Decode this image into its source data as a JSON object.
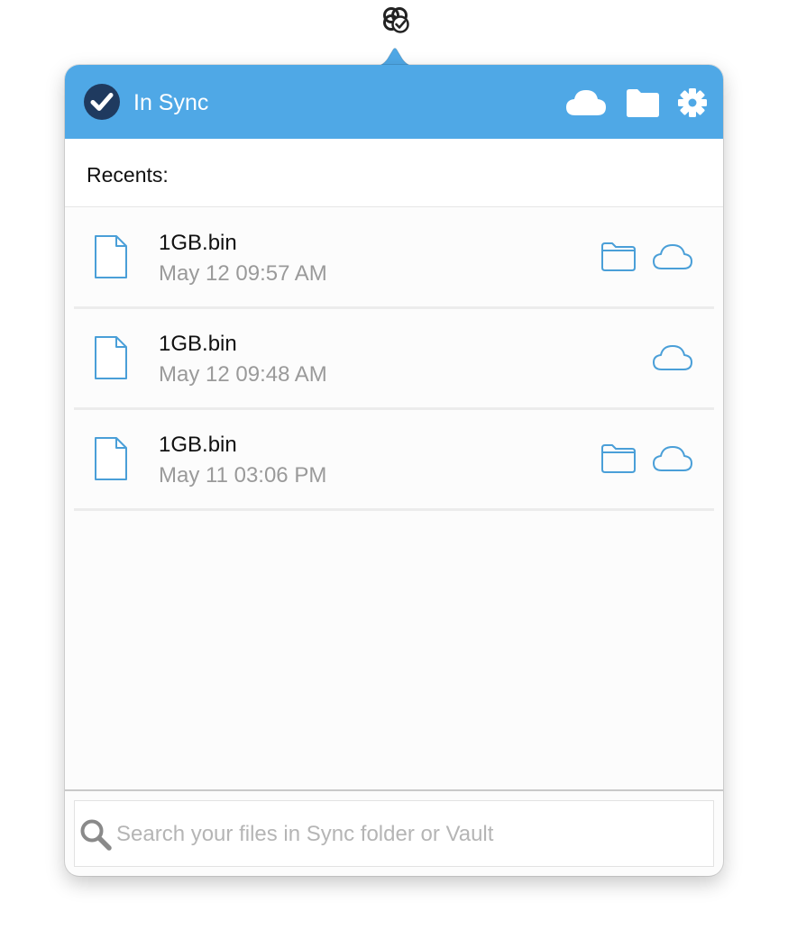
{
  "menubar": {
    "icon": "sync-tray-icon"
  },
  "header": {
    "status_label": "In Sync",
    "status_icon": "check-circle-icon",
    "buttons": [
      "cloud-icon",
      "folder-icon",
      "gear-icon"
    ],
    "color": "#4fa8e6"
  },
  "recents": {
    "label": "Recents:",
    "items": [
      {
        "name": "1GB.bin",
        "date": "May 12 09:57 AM",
        "folder_button": true,
        "cloud_button": true
      },
      {
        "name": "1GB.bin",
        "date": "May 12 09:48 AM",
        "folder_button": false,
        "cloud_button": true
      },
      {
        "name": "1GB.bin",
        "date": "May 11 03:06 PM",
        "folder_button": true,
        "cloud_button": true
      }
    ]
  },
  "search": {
    "placeholder": "Search your files in Sync folder or Vault",
    "value": ""
  },
  "colors": {
    "accent": "#4fa8e6",
    "icon_outline": "#4a9fd8",
    "status_dark": "#1f3a5f"
  }
}
